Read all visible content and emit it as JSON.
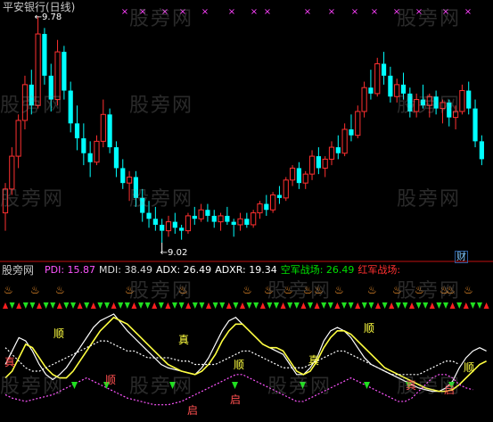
{
  "chart_data": [
    {
      "type": "candlestick",
      "title": "平安银行(日线)",
      "high_label": "9.78",
      "low_label": "9.02",
      "annotation": "财",
      "colors": {
        "up": "#ff3030",
        "down": "#00ffff",
        "background": "#000000",
        "marker": "#ff40ff"
      },
      "candles": [
        [
          9.12,
          9.22,
          9.06,
          9.2
        ],
        [
          9.2,
          9.34,
          9.18,
          9.31
        ],
        [
          9.31,
          9.45,
          9.27,
          9.43
        ],
        [
          9.43,
          9.58,
          9.4,
          9.55
        ],
        [
          9.55,
          9.6,
          9.45,
          9.48
        ],
        [
          9.48,
          9.78,
          9.47,
          9.72
        ],
        [
          9.72,
          9.74,
          9.55,
          9.58
        ],
        [
          9.58,
          9.62,
          9.46,
          9.5
        ],
        [
          9.5,
          9.7,
          9.48,
          9.66
        ],
        [
          9.66,
          9.68,
          9.5,
          9.53
        ],
        [
          9.53,
          9.56,
          9.39,
          9.42
        ],
        [
          9.42,
          9.48,
          9.33,
          9.37
        ],
        [
          9.37,
          9.42,
          9.28,
          9.32
        ],
        [
          9.32,
          9.36,
          9.24,
          9.29
        ],
        [
          9.29,
          9.38,
          9.28,
          9.36
        ],
        [
          9.36,
          9.5,
          9.34,
          9.45
        ],
        [
          9.45,
          9.47,
          9.32,
          9.34
        ],
        [
          9.34,
          9.36,
          9.24,
          9.27
        ],
        [
          9.27,
          9.3,
          9.2,
          9.22
        ],
        [
          9.22,
          9.26,
          9.16,
          9.24
        ],
        [
          9.24,
          9.26,
          9.14,
          9.17
        ],
        [
          9.17,
          9.2,
          9.09,
          9.12
        ],
        [
          9.12,
          9.16,
          9.07,
          9.1
        ],
        [
          9.1,
          9.14,
          9.06,
          9.08
        ],
        [
          9.08,
          9.1,
          9.02,
          9.06
        ],
        [
          9.06,
          9.11,
          9.04,
          9.09
        ],
        [
          9.09,
          9.12,
          9.05,
          9.07
        ],
        [
          9.07,
          9.08,
          9.03,
          9.06
        ],
        [
          9.06,
          9.12,
          9.05,
          9.11
        ],
        [
          9.11,
          9.14,
          9.08,
          9.1
        ],
        [
          9.1,
          9.15,
          9.09,
          9.13
        ],
        [
          9.13,
          9.15,
          9.09,
          9.11
        ],
        [
          9.11,
          9.13,
          9.07,
          9.09
        ],
        [
          9.09,
          9.12,
          9.06,
          9.11
        ],
        [
          9.11,
          9.14,
          9.08,
          9.09
        ],
        [
          9.09,
          9.1,
          9.04,
          9.08
        ],
        [
          9.08,
          9.12,
          9.06,
          9.1
        ],
        [
          9.1,
          9.12,
          9.07,
          9.08
        ],
        [
          9.08,
          9.13,
          9.07,
          9.12
        ],
        [
          9.12,
          9.16,
          9.1,
          9.15
        ],
        [
          9.15,
          9.18,
          9.11,
          9.13
        ],
        [
          9.13,
          9.19,
          9.12,
          9.18
        ],
        [
          9.18,
          9.21,
          9.15,
          9.17
        ],
        [
          9.17,
          9.24,
          9.16,
          9.23
        ],
        [
          9.23,
          9.28,
          9.21,
          9.27
        ],
        [
          9.27,
          9.29,
          9.2,
          9.22
        ],
        [
          9.22,
          9.26,
          9.2,
          9.25
        ],
        [
          9.25,
          9.33,
          9.23,
          9.31
        ],
        [
          9.31,
          9.34,
          9.25,
          9.27
        ],
        [
          9.27,
          9.31,
          9.24,
          9.3
        ],
        [
          9.3,
          9.36,
          9.28,
          9.34
        ],
        [
          9.34,
          9.38,
          9.3,
          9.32
        ],
        [
          9.32,
          9.42,
          9.31,
          9.4
        ],
        [
          9.4,
          9.45,
          9.36,
          9.38
        ],
        [
          9.38,
          9.48,
          9.37,
          9.46
        ],
        [
          9.46,
          9.56,
          9.44,
          9.54
        ],
        [
          9.54,
          9.6,
          9.5,
          9.52
        ],
        [
          9.52,
          9.64,
          9.51,
          9.62
        ],
        [
          9.62,
          9.66,
          9.55,
          9.58
        ],
        [
          9.58,
          9.61,
          9.49,
          9.51
        ],
        [
          9.51,
          9.57,
          9.49,
          9.55
        ],
        [
          9.55,
          9.59,
          9.5,
          9.52
        ],
        [
          9.52,
          9.54,
          9.44,
          9.46
        ],
        [
          9.46,
          9.52,
          9.44,
          9.5
        ],
        [
          9.5,
          9.55,
          9.47,
          9.48
        ],
        [
          9.48,
          9.52,
          9.44,
          9.51
        ],
        [
          9.51,
          9.53,
          9.45,
          9.47
        ],
        [
          9.47,
          9.5,
          9.42,
          9.49
        ],
        [
          9.49,
          9.5,
          9.41,
          9.44
        ],
        [
          9.44,
          9.48,
          9.4,
          9.46
        ],
        [
          9.46,
          9.55,
          9.45,
          9.53
        ],
        [
          9.53,
          9.56,
          9.45,
          9.47
        ],
        [
          9.47,
          9.5,
          9.34,
          9.36
        ],
        [
          9.36,
          9.38,
          9.28,
          9.3
        ]
      ]
    },
    {
      "type": "line",
      "panel_label": "股旁网",
      "indicators": [
        {
          "name": "PDI",
          "value": "15.87",
          "color": "#ff55ff"
        },
        {
          "name": "MDI",
          "value": "38.49",
          "color": "#dddddd"
        },
        {
          "name": "ADX",
          "value": "26.49",
          "color": "#ffffff"
        },
        {
          "name": "ADXR",
          "value": "19.34",
          "color": "#ffffff"
        },
        {
          "name": "空军战场",
          "value": "26.49",
          "color": "#00e000"
        },
        {
          "name": "红军战场",
          "value": "",
          "color": "#ff3030"
        }
      ],
      "series": [
        {
          "name": "MDI",
          "color": "#ffffff",
          "values": [
            30,
            38,
            46,
            44,
            38,
            30,
            24,
            21,
            24,
            28,
            34,
            40,
            46,
            52,
            56,
            58,
            60,
            55,
            50,
            46,
            42,
            38,
            34,
            30,
            28,
            27,
            26,
            25,
            24,
            28,
            34,
            42,
            50,
            56,
            58,
            54,
            50,
            46,
            42,
            40,
            38,
            36,
            30,
            24,
            24,
            28,
            34,
            44,
            50,
            52,
            50,
            46,
            40,
            34,
            30,
            28,
            26,
            24,
            22,
            20,
            18,
            16,
            15,
            14,
            14,
            16,
            20,
            28,
            34,
            38,
            40,
            38
          ]
        },
        {
          "name": "ADX",
          "color": "#ffff40",
          "values": [
            22,
            26,
            34,
            42,
            40,
            34,
            28,
            24,
            22,
            22,
            26,
            32,
            38,
            44,
            50,
            54,
            58,
            56,
            54,
            50,
            46,
            42,
            38,
            34,
            30,
            28,
            26,
            25,
            24,
            26,
            30,
            36,
            44,
            50,
            54,
            54,
            50,
            46,
            42,
            40,
            40,
            38,
            32,
            26,
            24,
            26,
            32,
            40,
            46,
            50,
            50,
            48,
            44,
            40,
            36,
            32,
            28,
            26,
            24,
            22,
            20,
            18,
            16,
            15,
            14,
            14,
            15,
            18,
            22,
            26,
            30,
            32
          ]
        },
        {
          "name": "ADXR",
          "color": "#ffffff",
          "values": [
            40,
            36,
            32,
            28,
            26,
            26,
            28,
            30,
            32,
            34,
            36,
            38,
            40,
            42,
            44,
            44,
            42,
            40,
            38,
            38,
            36,
            34,
            34,
            34,
            34,
            33,
            32,
            32,
            30,
            30,
            30,
            30,
            32,
            34,
            36,
            38,
            38,
            36,
            34,
            32,
            30,
            28,
            28,
            28,
            28,
            30,
            32,
            34,
            36,
            38,
            38,
            36,
            34,
            32,
            30,
            28,
            26,
            24,
            24,
            24,
            24,
            24,
            26,
            28,
            30,
            32,
            32,
            30
          ]
        },
        {
          "name": "PDI",
          "color": "#ff55ff",
          "values": [
            12,
            10,
            9,
            8,
            9,
            10,
            11,
            12,
            14,
            16,
            18,
            20,
            22,
            20,
            18,
            16,
            14,
            12,
            10,
            9,
            8,
            7,
            6,
            6,
            6,
            7,
            8,
            10,
            12,
            14,
            16,
            18,
            20,
            22,
            24,
            24,
            22,
            20,
            18,
            16,
            14,
            12,
            10,
            8,
            8,
            10,
            12,
            14,
            16,
            18,
            20,
            22,
            20,
            18,
            16,
            14,
            12,
            10,
            8,
            8,
            10,
            14,
            18,
            22,
            24,
            24,
            22,
            18,
            16,
            15
          ]
        }
      ],
      "text_marks": [
        "真",
        "顺",
        "顺",
        "真",
        "顺",
        "启",
        "启",
        "真",
        "顺",
        "真",
        "启",
        "顺"
      ]
    }
  ]
}
